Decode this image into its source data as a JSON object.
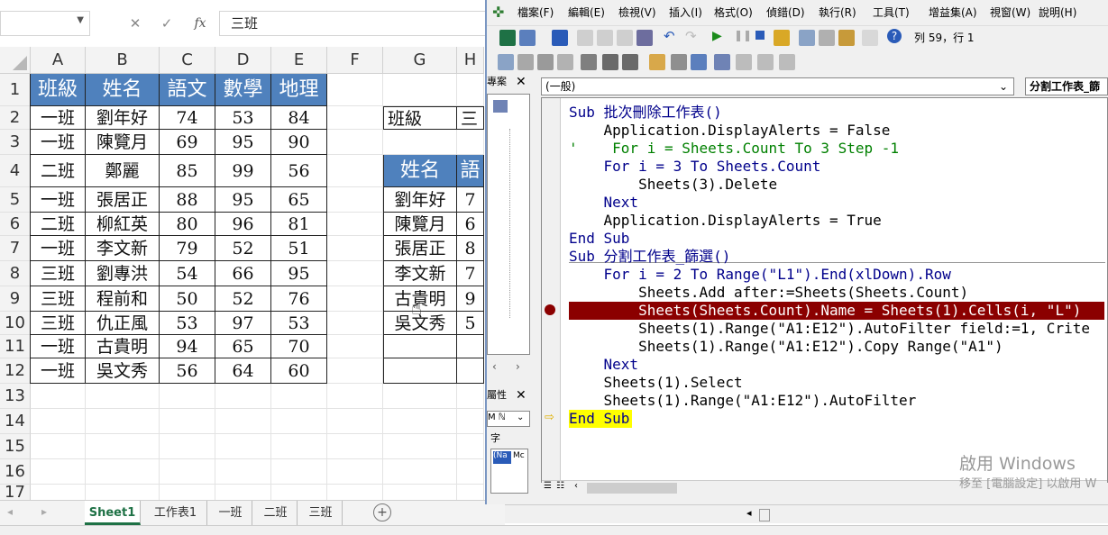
{
  "excel": {
    "namebox": "",
    "formula": "三班",
    "fx_label": "fx",
    "columns": [
      "A",
      "B",
      "C",
      "D",
      "E",
      "F",
      "G",
      "H"
    ],
    "rows": [
      "1",
      "2",
      "3",
      "4",
      "5",
      "6",
      "7",
      "8",
      "9",
      "10",
      "11",
      "12",
      "13",
      "14",
      "15",
      "16",
      "17"
    ],
    "table_header": [
      "班級",
      "姓名",
      "語文",
      "數學",
      "地理"
    ],
    "table_rows": [
      [
        "一班",
        "劉年好",
        "74",
        "53",
        "84"
      ],
      [
        "一班",
        "陳覽月",
        "69",
        "95",
        "90"
      ],
      [
        "二班",
        "鄭麗",
        "85",
        "99",
        "56"
      ],
      [
        "一班",
        "張居正",
        "88",
        "95",
        "65"
      ],
      [
        "二班",
        "柳紅英",
        "80",
        "96",
        "81"
      ],
      [
        "一班",
        "李文新",
        "79",
        "52",
        "51"
      ],
      [
        "三班",
        "劉專洪",
        "54",
        "66",
        "95"
      ],
      [
        "三班",
        "程前和",
        "50",
        "52",
        "76"
      ],
      [
        "三班",
        "仇正風",
        "53",
        "97",
        "53"
      ],
      [
        "一班",
        "古貴明",
        "94",
        "65",
        "70"
      ],
      [
        "一班",
        "吳文秀",
        "56",
        "64",
        "60"
      ]
    ],
    "filter_label": "班級",
    "filter_value": "三",
    "right_header": [
      "姓名",
      "語"
    ],
    "right_rows": [
      [
        "劉年好",
        "7"
      ],
      [
        "陳覽月",
        "6"
      ],
      [
        "張居正",
        "8"
      ],
      [
        "李文新",
        "7"
      ],
      [
        "古貴明",
        "9"
      ],
      [
        "吳文秀",
        "5"
      ]
    ],
    "tabs": [
      "Sheet1",
      "工作表1",
      "一班",
      "二班",
      "三班"
    ]
  },
  "vbe": {
    "menus": [
      "檔案(F)",
      "編輯(E)",
      "檢視(V)",
      "插入(I)",
      "格式(O)",
      "偵錯(D)",
      "執行(R)",
      "工具(T)",
      "增益集(A)",
      "視窗(W)",
      "說明(H)"
    ],
    "position": "列 59，行 1",
    "project_title": "專案",
    "props_title": "屬性",
    "proc_combo": "(一般)",
    "obj_combo": "分割工作表_篩",
    "props_combo": "M ℕ",
    "props_tab": "字",
    "props_cell1": "(Na",
    "props_cell2": "Mc",
    "code": [
      "Sub 批次刪除工作表()",
      "    Application.DisplayAlerts = False",
      "'    For i = Sheets.Count To 3 Step -1",
      "    For i = 3 To Sheets.Count",
      "        Sheets(3).Delete",
      "    Next",
      "    Application.DisplayAlerts = True",
      "End Sub",
      "Sub 分割工作表_篩選()",
      "    For i = 2 To Range(\"L1\").End(xlDown).Row",
      "        Sheets.Add after:=Sheets(Sheets.Count)",
      "        Sheets(Sheets.Count).Name = Sheets(1).Cells(i, \"L\")",
      "        Sheets(1).Range(\"A1:E12\").AutoFilter field:=1, Crite",
      "        Sheets(1).Range(\"A1:E12\").Copy Range(\"A1\")",
      "    Next",
      "    Sheets(1).Select",
      "    Sheets(1).Range(\"A1:E12\").AutoFilter",
      "End Sub"
    ],
    "watermark_line1": "啟用 Windows",
    "watermark_line2": "移至 [電腦設定] 以啟用 W"
  },
  "colors": {
    "header_blue": "#4f81bd",
    "breakpoint": "#8b0000",
    "current_line": "#ffff00"
  }
}
